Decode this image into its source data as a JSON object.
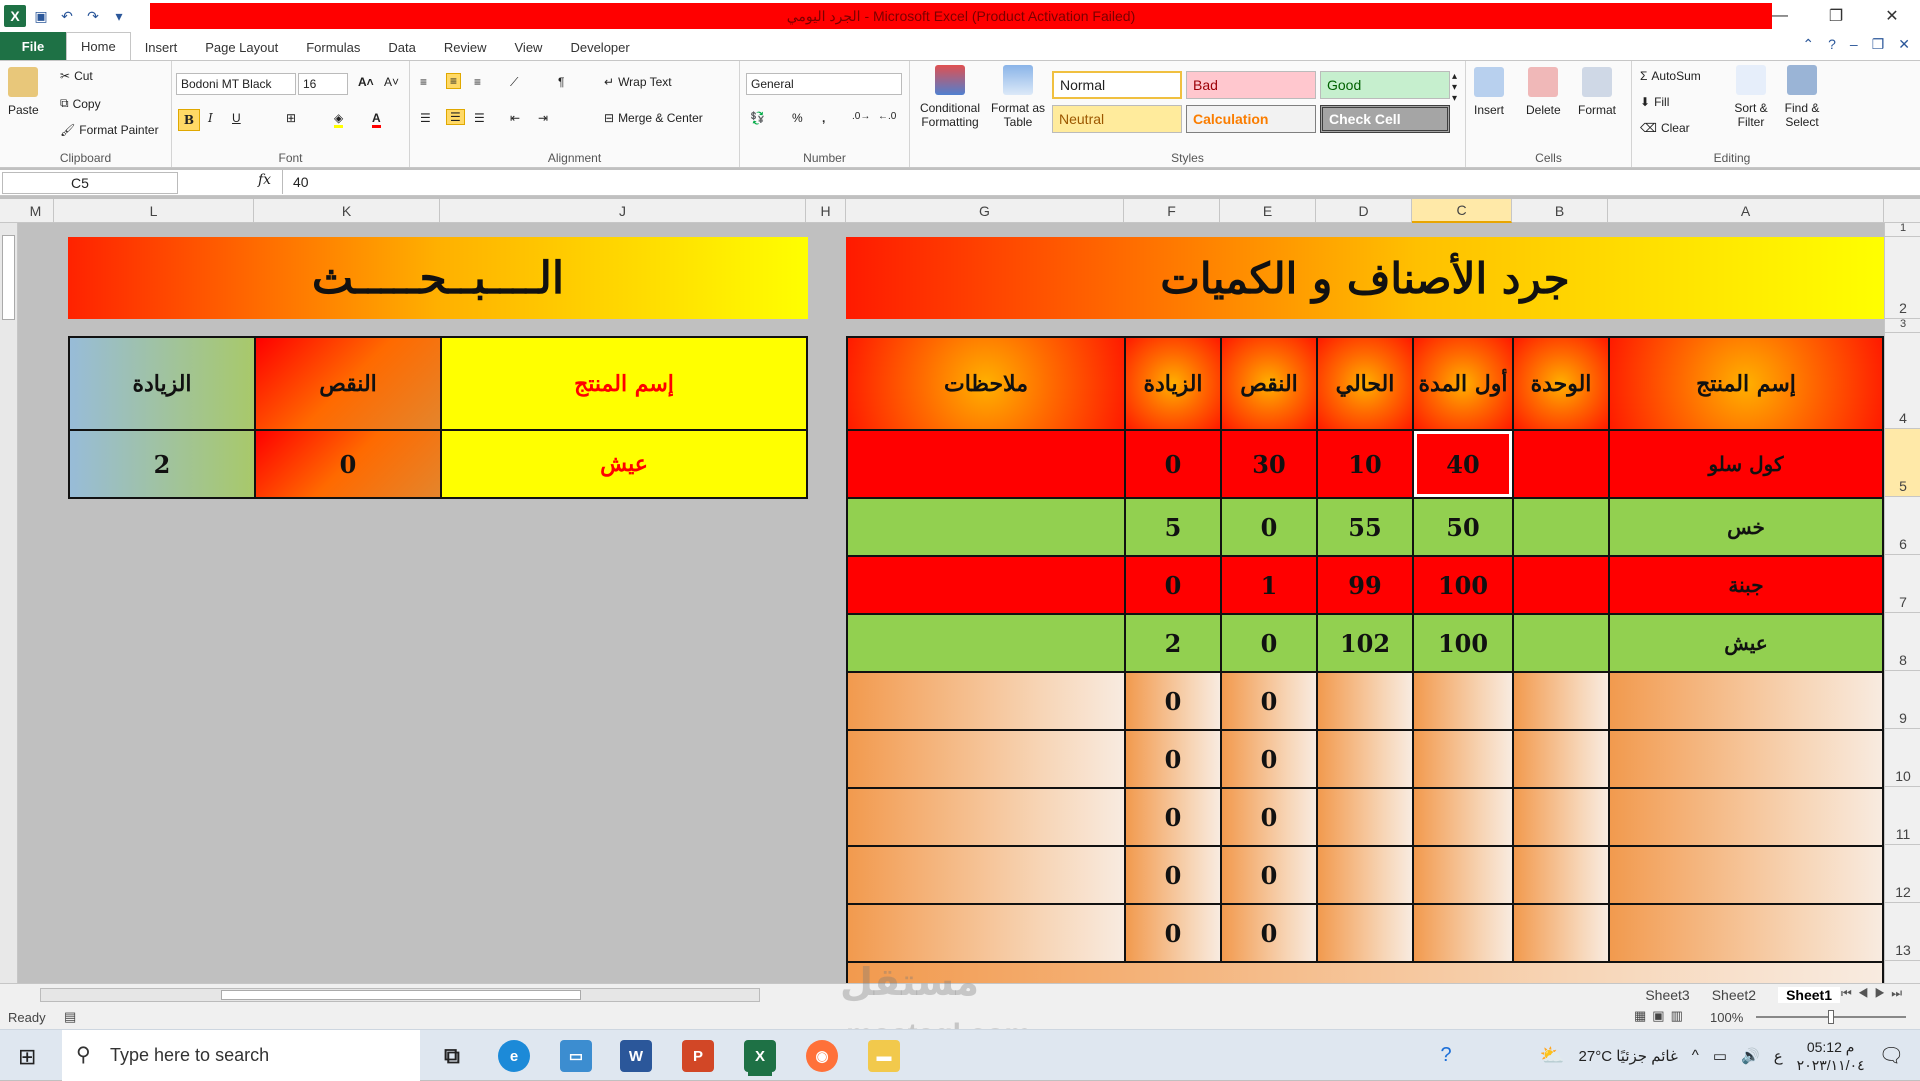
{
  "app": {
    "title": "الجرد اليومي  -  Microsoft Excel (Product Activation Failed)"
  },
  "tabs": [
    "File",
    "Home",
    "Insert",
    "Page Layout",
    "Formulas",
    "Data",
    "Review",
    "View",
    "Developer"
  ],
  "ribbon": {
    "clipboard": {
      "paste": "Paste",
      "cut": "Cut",
      "copy": "Copy",
      "format_painter": "Format Painter",
      "label": "Clipboard"
    },
    "font": {
      "name": "Bodoni MT Black",
      "size": "16",
      "label": "Font",
      "bold": "B",
      "italic": "I",
      "underline": "U"
    },
    "alignment": {
      "wrap": "Wrap Text",
      "merge": "Merge & Center",
      "label": "Alignment"
    },
    "number": {
      "format": "General",
      "label": "Number",
      "percent": "%",
      "comma": ","
    },
    "styles": {
      "conditional": "Conditional Formatting",
      "format_table": "Format as Table",
      "normal": "Normal",
      "bad": "Bad",
      "good": "Good",
      "neutral": "Neutral",
      "calculation": "Calculation",
      "check_cell": "Check Cell",
      "label": "Styles"
    },
    "cells": {
      "insert": "Insert",
      "delete": "Delete",
      "format": "Format",
      "label": "Cells"
    },
    "editing": {
      "autosum": "AutoSum",
      "fill": "Fill",
      "clear": "Clear",
      "sort": "Sort & Filter",
      "find": "Find & Select",
      "label": "Editing"
    }
  },
  "formula": {
    "name_box": "C5",
    "fx": "fx",
    "value": "40"
  },
  "columns": [
    "M",
    "L",
    "K",
    "J",
    "H",
    "G",
    "F",
    "E",
    "D",
    "C",
    "B",
    "A"
  ],
  "rows": [
    "1",
    "2",
    "3",
    "4",
    "5",
    "6",
    "7",
    "8",
    "9",
    "10",
    "11",
    "12",
    "13"
  ],
  "main": {
    "title": "جرد الأصناف و الكميات",
    "headers": {
      "notes": "ملاحظات",
      "increase": "الزيادة",
      "decrease": "النقص",
      "current": "الحالي",
      "start": "أول المدة",
      "unit": "الوحدة",
      "product": "إسم المنتج"
    },
    "rows": [
      {
        "product": "كول سلو",
        "unit": "",
        "start": "40",
        "current": "10",
        "decrease": "30",
        "increase": "0",
        "notes": ""
      },
      {
        "product": "خس",
        "unit": "",
        "start": "50",
        "current": "55",
        "decrease": "0",
        "increase": "5",
        "notes": ""
      },
      {
        "product": "جبنة",
        "unit": "",
        "start": "100",
        "current": "99",
        "decrease": "1",
        "increase": "0",
        "notes": ""
      },
      {
        "product": "عيش",
        "unit": "",
        "start": "100",
        "current": "102",
        "decrease": "0",
        "increase": "2",
        "notes": ""
      },
      {
        "product": "",
        "unit": "",
        "start": "",
        "current": "",
        "decrease": "0",
        "increase": "0",
        "notes": ""
      },
      {
        "product": "",
        "unit": "",
        "start": "",
        "current": "",
        "decrease": "0",
        "increase": "0",
        "notes": ""
      },
      {
        "product": "",
        "unit": "",
        "start": "",
        "current": "",
        "decrease": "0",
        "increase": "0",
        "notes": ""
      },
      {
        "product": "",
        "unit": "",
        "start": "",
        "current": "",
        "decrease": "0",
        "increase": "0",
        "notes": ""
      },
      {
        "product": "",
        "unit": "",
        "start": "",
        "current": "",
        "decrease": "0",
        "increase": "0",
        "notes": ""
      }
    ]
  },
  "search": {
    "title": "الــــبــحـــــث",
    "headers": {
      "product": "إسم المنتج",
      "decrease": "النقص",
      "increase": "الزيادة"
    },
    "row": {
      "product": "عيش",
      "decrease": "0",
      "increase": "2"
    }
  },
  "sheets": [
    "Sheet3",
    "Sheet2",
    "Sheet1"
  ],
  "status": {
    "ready": "Ready",
    "zoom": "100%"
  },
  "taskbar": {
    "search_placeholder": "Type here to search",
    "weather": "27°C  غائم جزئيًا",
    "time": "05:12 م",
    "date": "٢٠٢٣/١١/٠٤",
    "lang": "ع"
  },
  "watermark": {
    "logo": "مستقل",
    "site": "mostaql.com"
  },
  "colors": {
    "excel_green": "#1e7145",
    "title_red": "#ff0000",
    "row_red": "#ff0000",
    "row_green": "#92d050"
  }
}
